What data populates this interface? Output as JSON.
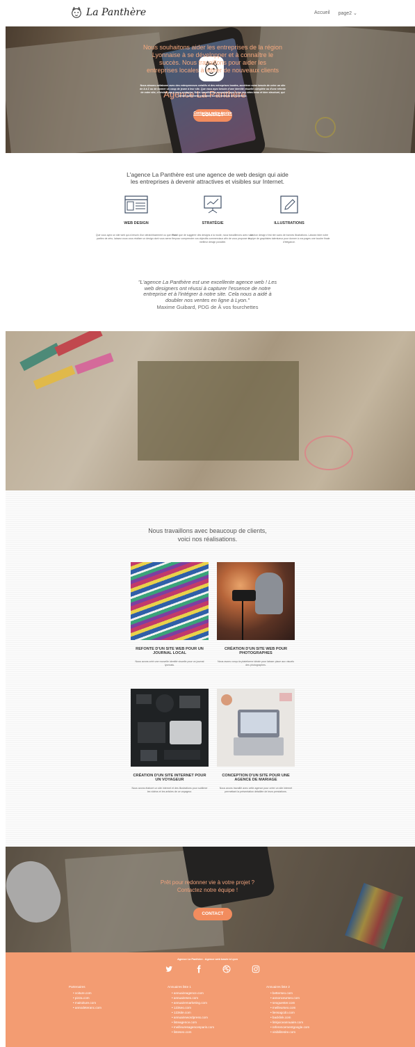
{
  "header": {
    "logo_text": "La Panthère",
    "nav": {
      "home": "Accueil",
      "page2": "page2 ⌄"
    }
  },
  "hero": {
    "title": "Agence La Panthère",
    "button": "CONTACT"
  },
  "intro": {
    "line1": "L'agence La Panthère est une agence de web design qui aide",
    "line2": "les entreprises à devenir attractives et visibles sur Internet."
  },
  "features": [
    {
      "title": "WEB DESIGN",
      "icon": "browser-icon",
      "text": "Que vous ayez un site web qui a besoin d'un rafraîchissement ou que vous partiez de zéro, laissez-nous vous réaliser un design dont vous serez fier."
    },
    {
      "title": "STRATÉGIE",
      "icon": "presentation-icon",
      "text": "Plutôt que de suggérer des designs à la mode, nous travaillerons avec vous pour comprendre vos objectifs commerciaux afin de vous proposer le meilleur design possible."
    },
    {
      "title": "ILLUSTRATIONS",
      "icon": "pencil-icon",
      "text": "Un bon design n'est rien sans de bonnes illustrations. Laissez faire notre équipe de graphistes talentueux pour donner à vos pages une touche finale d'élégance."
    }
  ],
  "testimonial": {
    "lines": [
      "\"L'agence La Panthère est une excellente agence web ! Les",
      "web designers ont réussi à capturer l'essence de notre",
      "entreprise et à l'intégrer à notre site. Cela nous a aidé à",
      "doubler nos ventes en ligne à Lyon.\""
    ],
    "author": "Maxime Guibard, PDG de À vos fourchettes"
  },
  "mission": {
    "title_lines": [
      "Nous souhaitons aider les entreprises de la région",
      "Lyonnaise à se développer et à connaître le",
      "succès. Nous travaillons pour aider les",
      "entreprises locales à attirer de nouveaux clients"
    ],
    "text": "Nous aimons collaborer avec des entrepreneurs créatifs et des entreprises locales, accélérer votre besoin de créer un site de A à Z ou de donner un coup de jeune à leur site. Que vous ayez besoin d'une identité visuelle complète ou d'une refonte de votre site, n'hésitez pas à nous contacter. Nous travaillerons ensemble pour créer des sites beau et bien structuré, qui seront facilement trouvable sur les moteurs de recherche.",
    "link": "Contactez notre équipe"
  },
  "works": {
    "title_lines": [
      "Nous travaillons avec beaucoup de clients,",
      "voici nos réalisations."
    ],
    "items": [
      {
        "title": "REFONTE D'UN SITE WEB POUR UN JOURNAL LOCAL",
        "text": "Nous avons créé une nouvelle identité visuelle pour un journal lyonnais."
      },
      {
        "title": "CRÉATION D'UN SITE WEB POUR PHOTOGRAPHES",
        "text": "Nous avons conçu la plateforme idéale pour laisser place aux visuels des photographes."
      },
      {
        "title": "CRÉATION D'UN SITE INTERNET POUR UN VOYAGEUR",
        "text": "Nous avons élaboré un site internet et des illustrations pour sublimer les vidéos et les articles de ce voyageur."
      },
      {
        "title": "CONCEPTION D'UN SITE POUR UNE AGENCE DE MARIAGE",
        "text": "Nous avons travaillé avec cette agence pour créer un site internet permettant la présentation détaillée de leurs prestations."
      }
    ]
  },
  "cta": {
    "line1": "Prêt pour redonner vie à votre projet ?",
    "line2": "Contactez notre équipe !",
    "button": "CONTACT"
  },
  "footer": {
    "title": "Agence La Panthère - Agence web basée à Lyon",
    "social": [
      "twitter-icon",
      "facebook-icon",
      "dribbble-icon",
      "instagram-icon"
    ],
    "columns": [
      {
        "heading": "Partenaires",
        "links": [
          "voiture.com",
          "pizza.com",
          "maitoiture.com",
          "annodeteranc.com"
        ]
      },
      {
        "heading": "Annuaires liste 1",
        "links": [
          "annuaireagence.com",
          "annuaireseo.com",
          "annuairemarketing.com",
          "123seo.com",
          "123site.com",
          "annuairewordpress.com",
          "listeagence.com",
          "meilleuresagencesparis.com",
          "listeseo.com"
        ]
      },
      {
        "heading": "Annuaires liste 2",
        "links": [
          "betterseo.com",
          "annonceurseo.com",
          "seoguester.com",
          "meilleurseo.com",
          "liensagcdo.com",
          "backlink.com",
          "linkjuiceannuaire.com",
          "referencementgoogle.com",
          "visibilitesite.com"
        ]
      }
    ]
  },
  "colors": {
    "accent": "#f28c5e",
    "footer": "#f39c72",
    "hero_title": "#f3a37c"
  }
}
